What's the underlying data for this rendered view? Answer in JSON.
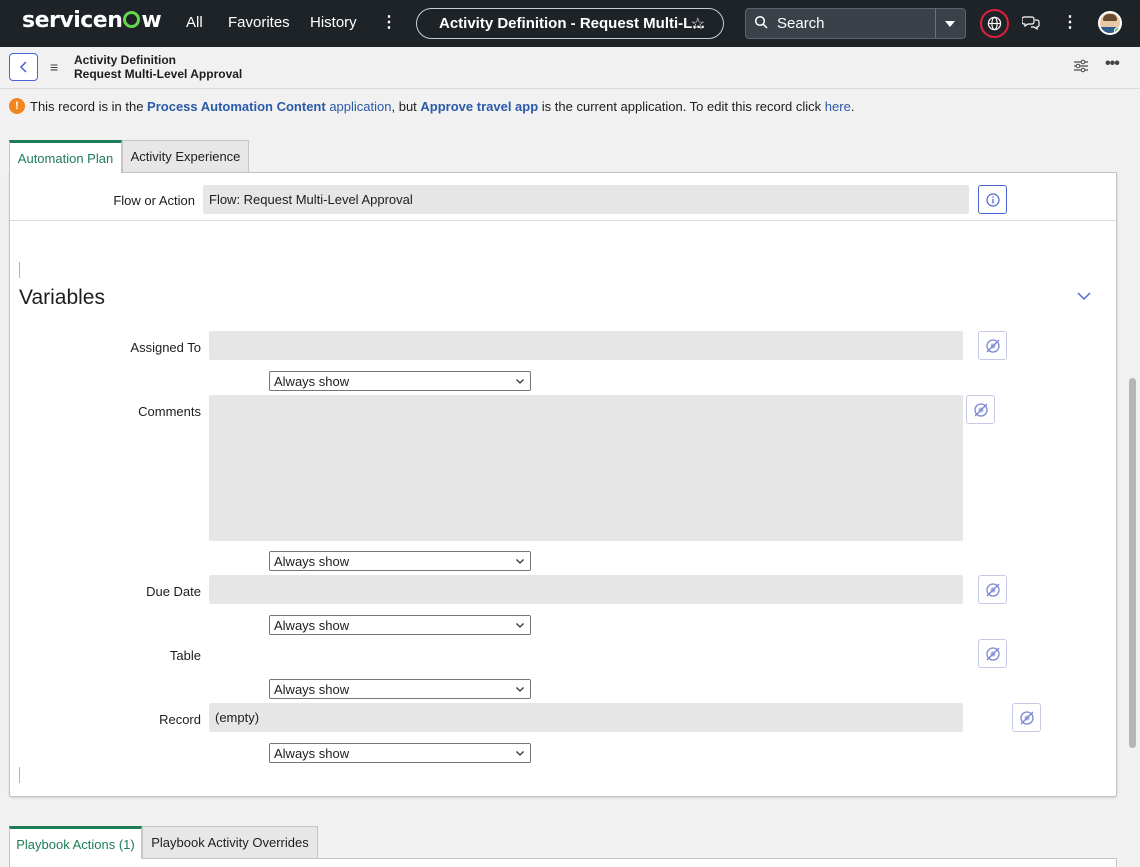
{
  "topnav": {
    "logo_text": [
      "servicen",
      "w"
    ],
    "links": [
      "All",
      "Favorites",
      "History"
    ],
    "more": "⋮",
    "context_pill": "Activity Definition - Request Multi-L...",
    "search_label": "Search",
    "kebab": "⋮"
  },
  "header": {
    "record_type": "Activity Definition",
    "record_name": "Request Multi-Level Approval",
    "more": "•••"
  },
  "info_message": {
    "prefix": "This record is in the ",
    "app_name": "Process Automation Content",
    "app_word": " application",
    "middle": ", but ",
    "current_app": "Approve travel app",
    "suffix": " is the current application. To edit this record click ",
    "link": "here",
    "end": "."
  },
  "tabs": [
    "Automation Plan",
    "Activity Experience"
  ],
  "form": {
    "flow_label": "Flow or Action",
    "flow_value": "Flow: Request Multi-Level Approval",
    "section_title": "Variables",
    "variables": [
      {
        "label": "Assigned To",
        "value": "",
        "visibility": "Always show"
      },
      {
        "label": "Comments",
        "value": "",
        "visibility": "Always show"
      },
      {
        "label": "Due Date",
        "value": "",
        "visibility": "Always show"
      },
      {
        "label": "Table",
        "value": "",
        "visibility": "Always show"
      },
      {
        "label": "Record",
        "value": "(empty)",
        "visibility": "Always show"
      }
    ]
  },
  "related_tabs": [
    "Playbook Actions (1)",
    "Playbook Activity Overrides"
  ],
  "colors": {
    "nav_bg": "#1e2328",
    "accent_green": "#1e7c56",
    "link_blue": "#2a5aa8",
    "field_bg": "#e6e6e7",
    "warning_orange": "#f0861d"
  }
}
